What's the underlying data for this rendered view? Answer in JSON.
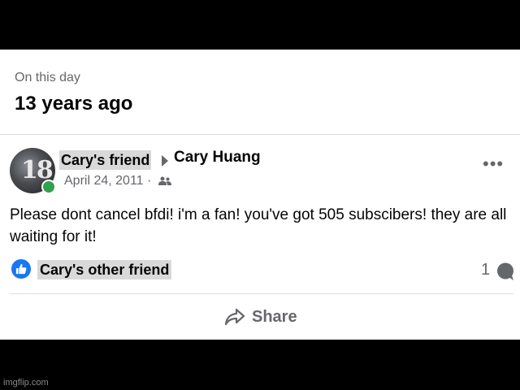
{
  "memory": {
    "label": "On this day",
    "years_ago": "13 years ago"
  },
  "post": {
    "author": "Cary's friend",
    "target": "Cary Huang",
    "date": "April 24, 2011",
    "separator": "·",
    "audience_icon": "friends-icon",
    "avatar_text": "18",
    "text": "Please dont cancel bfdi! i'm a fan! you've got 505 subscibers! they are all waiting for it!",
    "more_label": "•••"
  },
  "reactions": {
    "icon": "like-icon",
    "liker": "Cary's other friend",
    "comment_count": "1"
  },
  "actions": {
    "share_label": "Share"
  },
  "watermark": "imgflip.com",
  "colors": {
    "like_blue": "#1877f2",
    "online_green": "#31a24c",
    "secondary_text": "#65676b"
  }
}
